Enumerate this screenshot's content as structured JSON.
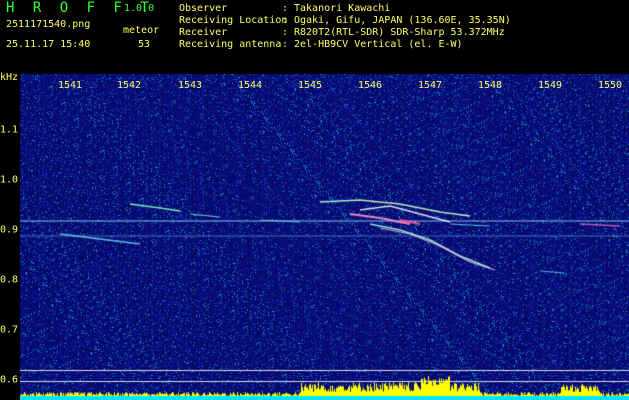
{
  "header": {
    "app_title": "H R O F F T",
    "app_version": "1.0.0",
    "filename": "2511171540.png",
    "meteor_label": "meteor",
    "timestamp": "25.11.17 15:40",
    "meteor_count": "53",
    "info": [
      {
        "key": "Observer",
        "value": "Takanori Kawachi"
      },
      {
        "key": "Receiving Location",
        "value": "Ogaki, Gifu, JAPAN (136.60E, 35.35N)"
      },
      {
        "key": "Receiver",
        "value": "R820T2(RTL-SDR) SDR-Sharp 53.372MHz"
      },
      {
        "key": "Receiving antenna",
        "value": "2el-HB9CV Vertical (el. E-W)"
      }
    ],
    "separator": ":"
  },
  "axis": {
    "y_unit": "kHz",
    "x_ticks": [
      "1541",
      "1542",
      "1543",
      "1544",
      "1545",
      "1546",
      "1547",
      "1548",
      "1549",
      "1550"
    ],
    "y_ticks": [
      "1.1",
      "1.0",
      "0.9",
      "0.8",
      "0.7",
      "0.6"
    ]
  },
  "colors": {
    "label_yellow": "#ffff66",
    "title_green": "#33ff33",
    "background": "#000000",
    "spectrum_base": "#0a0a6e",
    "level_bar": "#ffff00",
    "level_base": "#00e5ff"
  }
}
